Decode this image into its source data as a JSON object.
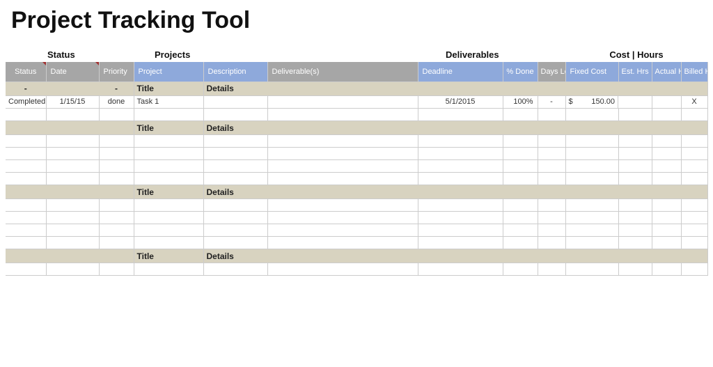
{
  "title": "Project Tracking Tool",
  "groupHeaders": {
    "status": "Status",
    "projects": "Projects",
    "deliverables": "Deliverables",
    "costHours": "Cost | Hours"
  },
  "columns": {
    "status": "Status",
    "date": "Date",
    "priority": "Priority",
    "project": "Project",
    "description": "Description",
    "deliverables": "Deliverable(s)",
    "deadline": "Deadline",
    "pctDone": "% Done",
    "daysLeft": "Days Left",
    "fixedCost": "Fixed Cost",
    "estHrs": "Est. Hrs",
    "actualHrs": "Actual Hrs",
    "billedHrs": "Billed Hrs"
  },
  "sections": [
    {
      "title": "Title",
      "details": "Details",
      "statusDash": "-",
      "priorityDash": "-",
      "rows": [
        {
          "status": "Completed",
          "date": "1/15/15",
          "priority": "done",
          "project": "Task 1",
          "description": "",
          "deliverables": "",
          "deadline": "5/1/2015",
          "pctDone": "100%",
          "daysLeft": "-",
          "fixedCostSym": "$",
          "fixedCost": "150.00",
          "estHrs": "",
          "actualHrs": "",
          "billedHrs": "X"
        },
        {}
      ]
    },
    {
      "title": "Title",
      "details": "Details",
      "rows": [
        {},
        {},
        {},
        {}
      ]
    },
    {
      "title": "Title",
      "details": "Details",
      "rows": [
        {},
        {},
        {},
        {}
      ]
    },
    {
      "title": "Title",
      "details": "Details",
      "rows": [
        {}
      ]
    }
  ]
}
